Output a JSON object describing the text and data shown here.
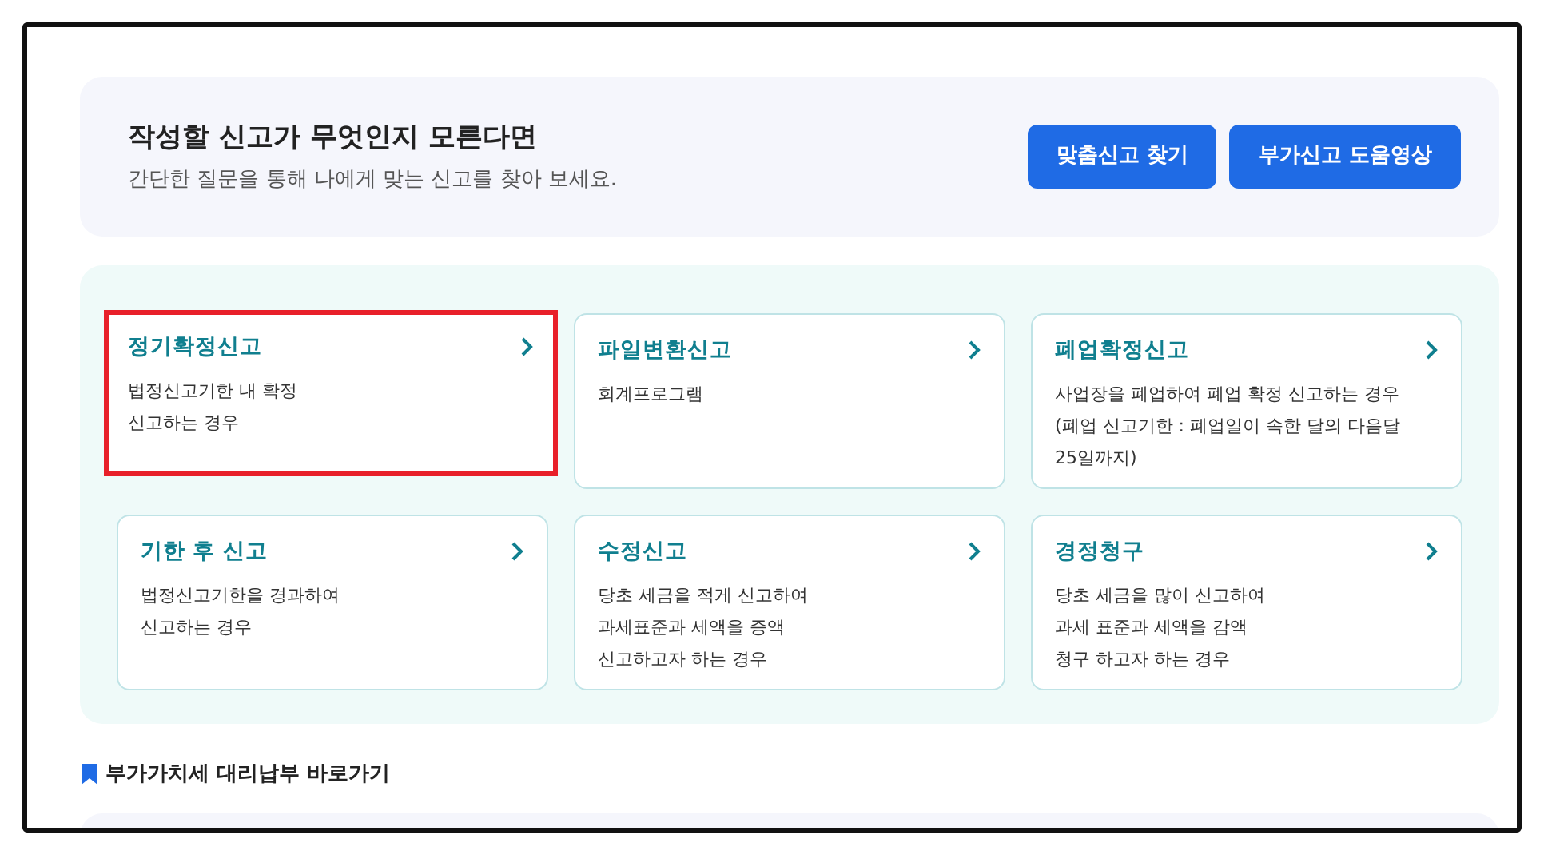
{
  "intro": {
    "title": "작성할 신고가 무엇인지 모른다면",
    "subtitle": "간단한 질문을 통해 나에게 맞는 신고를 찾아 보세요.",
    "buttons": [
      "맞춤신고 찾기",
      "부가신고 도움영상"
    ]
  },
  "cards": [
    {
      "title": "정기확정신고",
      "lines": [
        "법정신고기한 내 확정",
        "신고하는 경우"
      ],
      "highlighted": true
    },
    {
      "title": "파일변환신고",
      "lines": [
        "회계프로그램"
      ],
      "highlighted": false
    },
    {
      "title": "폐업확정신고",
      "lines": [
        "사업장을 폐업하여 폐업 확정 신고하는 경우",
        "(폐업 신고기한 : 폐업일이 속한 달의 다음달",
        "25일까지)"
      ],
      "highlighted": false
    },
    {
      "title": "기한 후 신고",
      "lines": [
        "법정신고기한을 경과하여",
        "신고하는 경우"
      ],
      "highlighted": false
    },
    {
      "title": "수정신고",
      "lines": [
        "당초 세금을 적게 신고하여",
        "과세표준과 세액을 증액",
        "신고하고자 하는 경우"
      ],
      "highlighted": false
    },
    {
      "title": "경정청구",
      "lines": [
        "당초 세금을 많이 신고하여",
        "과세 표준과 세액을 감액",
        "청구 하고자 하는 경우"
      ],
      "highlighted": false
    }
  ],
  "section": {
    "title": "부가가치세 대리납부 바로가기"
  }
}
